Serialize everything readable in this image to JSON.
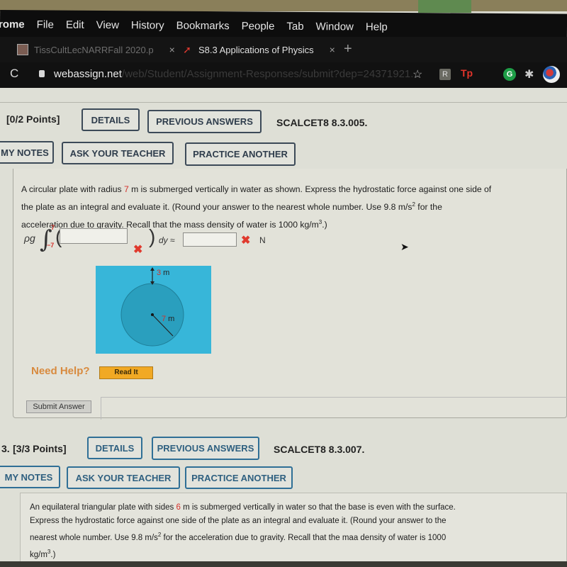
{
  "menubar": {
    "items": [
      "rome",
      "File",
      "Edit",
      "View",
      "History",
      "Bookmarks",
      "People",
      "Tab",
      "Window",
      "Help"
    ]
  },
  "tabs": [
    {
      "title": "TissCultLecNARRFall 2020.p",
      "close": "×",
      "active": false
    },
    {
      "title": "S8.3 Applications of Physics",
      "close": "×",
      "active": true
    }
  ],
  "new_tab": "+",
  "address": {
    "reload": "C",
    "domain": "webassign.net",
    "path": "/web/Student/Assignment-Responses/submit?dep=24371921..."
  },
  "extensions": {
    "star": "☆",
    "r_ext": "R",
    "tp_ext": "Tp",
    "g_ext": "G",
    "puzzle": "✱"
  },
  "question2": {
    "points": "[0/2 Points]",
    "details": "DETAILS",
    "previous_answers": "PREVIOUS ANSWERS",
    "code": "SCALCET8 8.3.005.",
    "my_notes": "MY NOTES",
    "ask_teacher": "ASK YOUR TEACHER",
    "practice_another": "PRACTICE ANOTHER",
    "text_1": "A circular plate with radius ",
    "radius": "7",
    "text_2": " m is submerged vertically in water as shown. Express the hydrostatic force against one side of",
    "text_3": "the plate as an integral and evaluate it. (Round your answer to the nearest whole number. Use 9.8 m/s",
    "text_3_sup": "2",
    "text_3_end": " for the",
    "text_4": "acceleration due to gravity. Recall that the mass density of water is 1000 kg/m",
    "text_4_sup": "3",
    "text_4_end": ".)",
    "integral": {
      "prefix": "ρg",
      "upper": "7",
      "lower": "−7",
      "integrand_value": "",
      "dy": "dy ≈",
      "answer_value": "",
      "unit": "N",
      "wrong_mark": "✖"
    },
    "figure": {
      "depth_label_num": "3",
      "depth_label_unit": " m",
      "radius_label_num": "7",
      "radius_label_unit": " m"
    },
    "need_help": "Need Help?",
    "read_it": "Read It",
    "submit": "Submit Answer"
  },
  "question3": {
    "number": "3.",
    "points": "[3/3 Points]",
    "details": "DETAILS",
    "previous_answers": "PREVIOUS ANSWERS",
    "code": "SCALCET8 8.3.007.",
    "my_notes": "MY NOTES",
    "ask_teacher": "ASK YOUR TEACHER",
    "practice_another": "PRACTICE ANOTHER",
    "text_1": "An equilateral triangular plate with sides ",
    "side": "6",
    "text_2": " m is submerged vertically in water so that the base is even with the surface.",
    "text_3": "Express the hydrostatic force against one side of the plate as an integral and evaluate it. (Round your answer to the",
    "text_4": "nearest whole number. Use 9.8 m/s",
    "text_4_sup": "2",
    "text_4_end": " for the acceleration due to gravity. Recall that the maa density of water is 1000",
    "text_5": "kg/m",
    "text_5_sup": "3",
    "text_5_end": ".)"
  }
}
